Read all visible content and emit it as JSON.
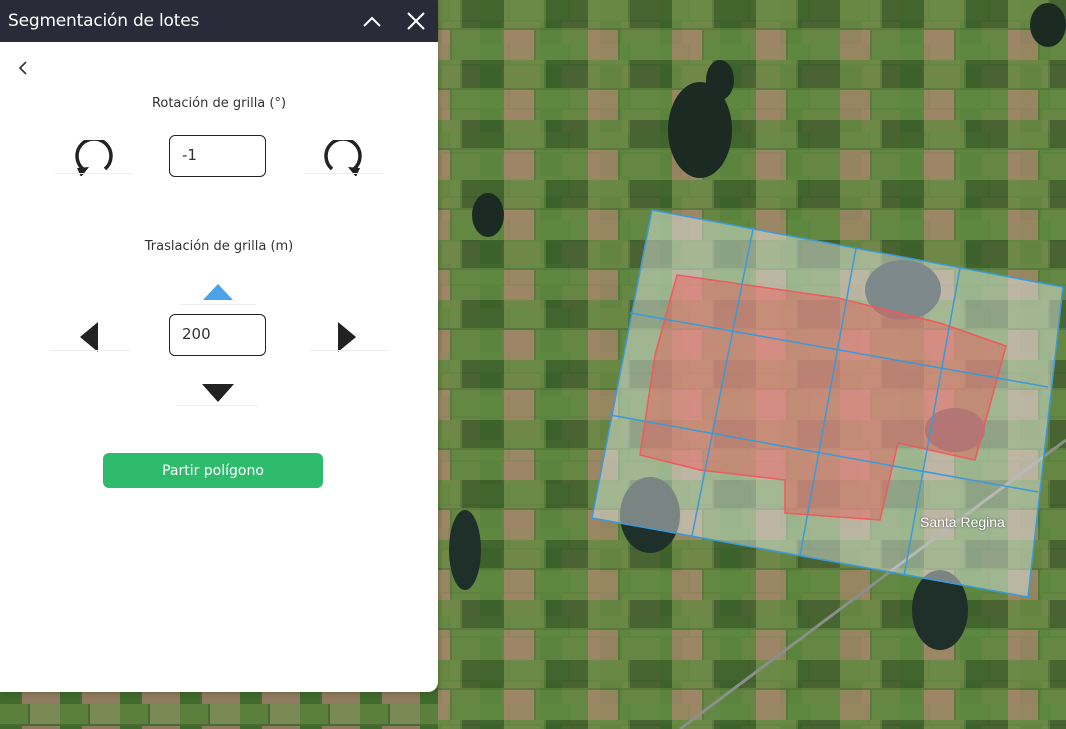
{
  "panel": {
    "title": "Segmentación de lotes",
    "icons": {
      "collapse": "chevron-up-icon",
      "close": "close-icon",
      "back": "chevron-left-icon"
    }
  },
  "rotation": {
    "label": "Rotación de grilla (°)",
    "value": "-1",
    "icons": {
      "left": "rotate-counterclockwise-icon",
      "right": "rotate-clockwise-icon"
    }
  },
  "translation": {
    "label": "Traslación de grilla (m)",
    "value": "200",
    "icons": {
      "up": "arrow-up-icon",
      "down": "arrow-down-icon",
      "left": "arrow-left-icon",
      "right": "arrow-right-icon"
    },
    "active_direction_color": "#4aa3e8"
  },
  "actions": {
    "split_label": "Partir polígono",
    "split_color": "#2fbb6c"
  },
  "map": {
    "place_label": "Santa Regina",
    "grid_color": "#3a9ad9",
    "polygon_color": "#f05a5a"
  }
}
